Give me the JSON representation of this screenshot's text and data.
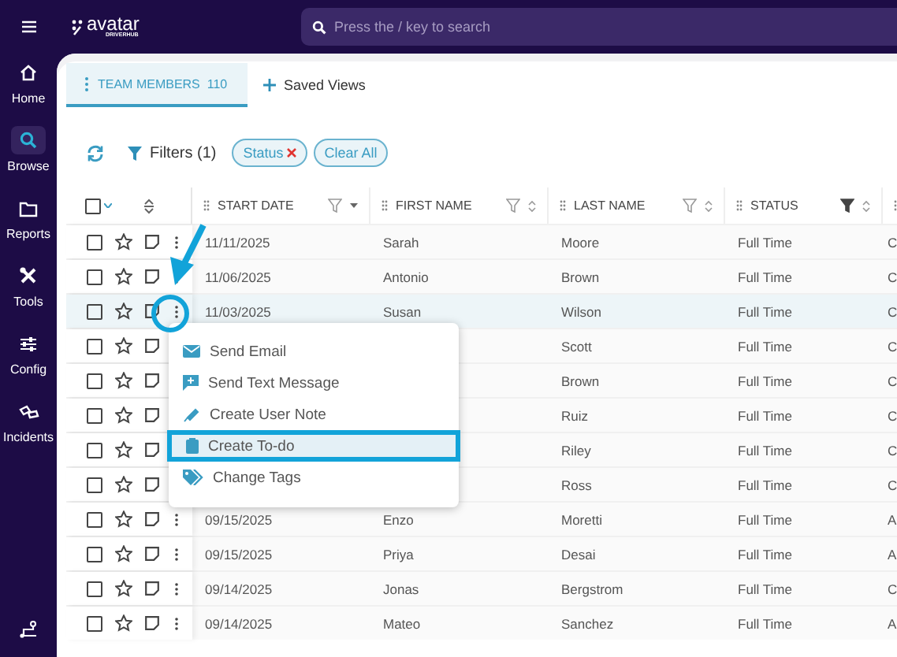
{
  "logo": {
    "name": "avatar",
    "sub": "DRIVERHUB"
  },
  "search": {
    "placeholder": "Press the / key to search"
  },
  "sidebar": {
    "items": [
      {
        "label": "Home",
        "kind": "home",
        "selected": false
      },
      {
        "label": "Browse",
        "kind": "search",
        "selected": true
      },
      {
        "label": "Reports",
        "kind": "folder",
        "selected": false
      },
      {
        "label": "Tools",
        "kind": "tools",
        "selected": false
      },
      {
        "label": "Config",
        "kind": "sliders",
        "selected": false
      },
      {
        "label": "Incidents",
        "kind": "incidents",
        "selected": false
      }
    ]
  },
  "tabs": [
    {
      "label": "TEAM MEMBERS",
      "count": "110",
      "selected": true
    }
  ],
  "saved_views": "Saved Views",
  "filters": {
    "label": "Filters (1)",
    "chips": [
      {
        "label": "Status",
        "removable": true
      },
      {
        "label": "Clear All",
        "removable": false
      }
    ]
  },
  "table": {
    "select_all_checked": false,
    "columns": [
      {
        "label": "START DATE",
        "filtered": false
      },
      {
        "label": "FIRST NAME",
        "filtered": false
      },
      {
        "label": "LAST NAME",
        "filtered": false
      },
      {
        "label": "STATUS",
        "filtered": true
      }
    ],
    "rows": [
      {
        "checked": false,
        "starred": false,
        "selected": false,
        "start_date": "11/11/2025",
        "first_name": "Sarah",
        "last_name": "Moore",
        "status": "Full Time",
        "column_6": "C"
      },
      {
        "checked": false,
        "starred": false,
        "selected": false,
        "start_date": "11/06/2025",
        "first_name": "Antonio",
        "last_name": "Brown",
        "status": "Full Time",
        "column_6": "C"
      },
      {
        "checked": false,
        "starred": false,
        "selected": true,
        "start_date": "11/03/2025",
        "first_name": "Susan",
        "last_name": "Wilson",
        "status": "Full Time",
        "column_6": "C"
      },
      {
        "checked": false,
        "starred": false,
        "selected": false,
        "last_name": "Scott",
        "status": "Full Time",
        "column_6": "C"
      },
      {
        "checked": false,
        "starred": false,
        "selected": false,
        "last_name": "Brown",
        "status": "Full Time",
        "column_6": "C"
      },
      {
        "checked": false,
        "starred": false,
        "selected": false,
        "last_name": "Ruiz",
        "status": "Full Time",
        "column_6": "C"
      },
      {
        "checked": false,
        "starred": false,
        "selected": false,
        "last_name": "Riley",
        "status": "Full Time",
        "column_6": "C"
      },
      {
        "checked": false,
        "starred": false,
        "selected": false,
        "last_name": "Ross",
        "status": "Full Time",
        "column_6": "C"
      },
      {
        "checked": false,
        "starred": false,
        "selected": false,
        "start_date": "09/15/2025",
        "first_name": "Enzo",
        "last_name": "Moretti",
        "status": "Full Time",
        "column_6": "A"
      },
      {
        "checked": false,
        "starred": false,
        "selected": false,
        "start_date": "09/15/2025",
        "first_name": "Priya",
        "last_name": "Desai",
        "status": "Full Time",
        "column_6": "A"
      },
      {
        "checked": false,
        "starred": false,
        "selected": false,
        "start_date": "09/14/2025",
        "first_name": "Jonas",
        "last_name": "Bergstrom",
        "status": "Full Time",
        "column_6": "C"
      },
      {
        "checked": false,
        "starred": false,
        "selected": false,
        "start_date": "09/14/2025",
        "first_name": "Mateo",
        "last_name": "Sanchez",
        "status": "Full Time",
        "column_6": "A"
      }
    ]
  },
  "context_menu": {
    "items": [
      {
        "label": "Send Email",
        "kind": "email",
        "highlighted": false
      },
      {
        "label": "Send Text Message",
        "kind": "sms",
        "highlighted": false
      },
      {
        "label": "Create User Note",
        "kind": "note",
        "highlighted": false
      },
      {
        "label": "Create To-do",
        "kind": "todo",
        "highlighted": true
      },
      {
        "label": "Change Tags",
        "kind": "tags",
        "highlighted": false
      }
    ]
  }
}
